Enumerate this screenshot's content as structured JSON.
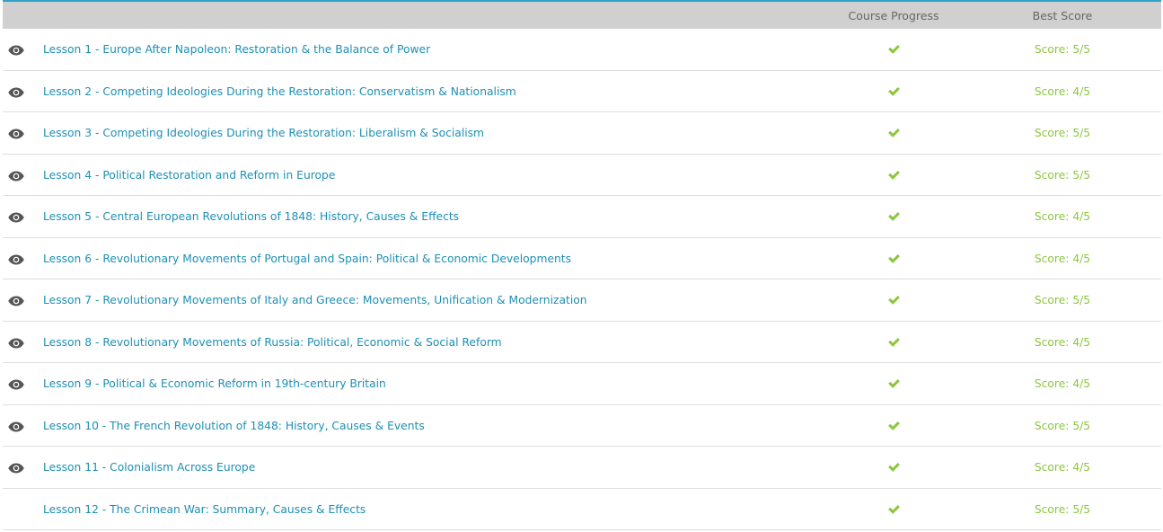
{
  "header": {
    "course_progress_label": "Course Progress",
    "best_score_label": "Best Score"
  },
  "colors": {
    "header_bg": "#d0d0d0",
    "accent_top": "#2fa2c6",
    "link": "#1e8fb4",
    "success": "#8cc63f"
  },
  "lessons": [
    {
      "title": "Lesson 1 - Europe After Napoleon: Restoration & the Balance of Power",
      "score": "Score: 5/5",
      "viewed": true,
      "completed": true
    },
    {
      "title": "Lesson 2 - Competing Ideologies During the Restoration: Conservatism & Nationalism",
      "score": "Score: 4/5",
      "viewed": true,
      "completed": true
    },
    {
      "title": "Lesson 3 - Competing Ideologies During the Restoration: Liberalism & Socialism",
      "score": "Score: 5/5",
      "viewed": true,
      "completed": true
    },
    {
      "title": "Lesson 4 - Political Restoration and Reform in Europe",
      "score": "Score: 5/5",
      "viewed": true,
      "completed": true
    },
    {
      "title": "Lesson 5 - Central European Revolutions of 1848: History, Causes & Effects",
      "score": "Score: 4/5",
      "viewed": true,
      "completed": true
    },
    {
      "title": "Lesson 6 - Revolutionary Movements of Portugal and Spain: Political & Economic Developments",
      "score": "Score: 4/5",
      "viewed": true,
      "completed": true
    },
    {
      "title": "Lesson 7 - Revolutionary Movements of Italy and Greece: Movements, Unification & Modernization",
      "score": "Score: 5/5",
      "viewed": true,
      "completed": true
    },
    {
      "title": "Lesson 8 - Revolutionary Movements of Russia: Political, Economic & Social Reform",
      "score": "Score: 4/5",
      "viewed": true,
      "completed": true
    },
    {
      "title": "Lesson 9 - Political & Economic Reform in 19th-century Britain",
      "score": "Score: 4/5",
      "viewed": true,
      "completed": true
    },
    {
      "title": "Lesson 10 - The French Revolution of 1848: History, Causes & Events",
      "score": "Score: 5/5",
      "viewed": true,
      "completed": true
    },
    {
      "title": "Lesson 11 - Colonialism Across Europe",
      "score": "Score: 4/5",
      "viewed": true,
      "completed": true
    },
    {
      "title": "Lesson 12 - The Crimean War: Summary, Causes & Effects",
      "score": "Score: 5/5",
      "viewed": false,
      "completed": true
    }
  ]
}
